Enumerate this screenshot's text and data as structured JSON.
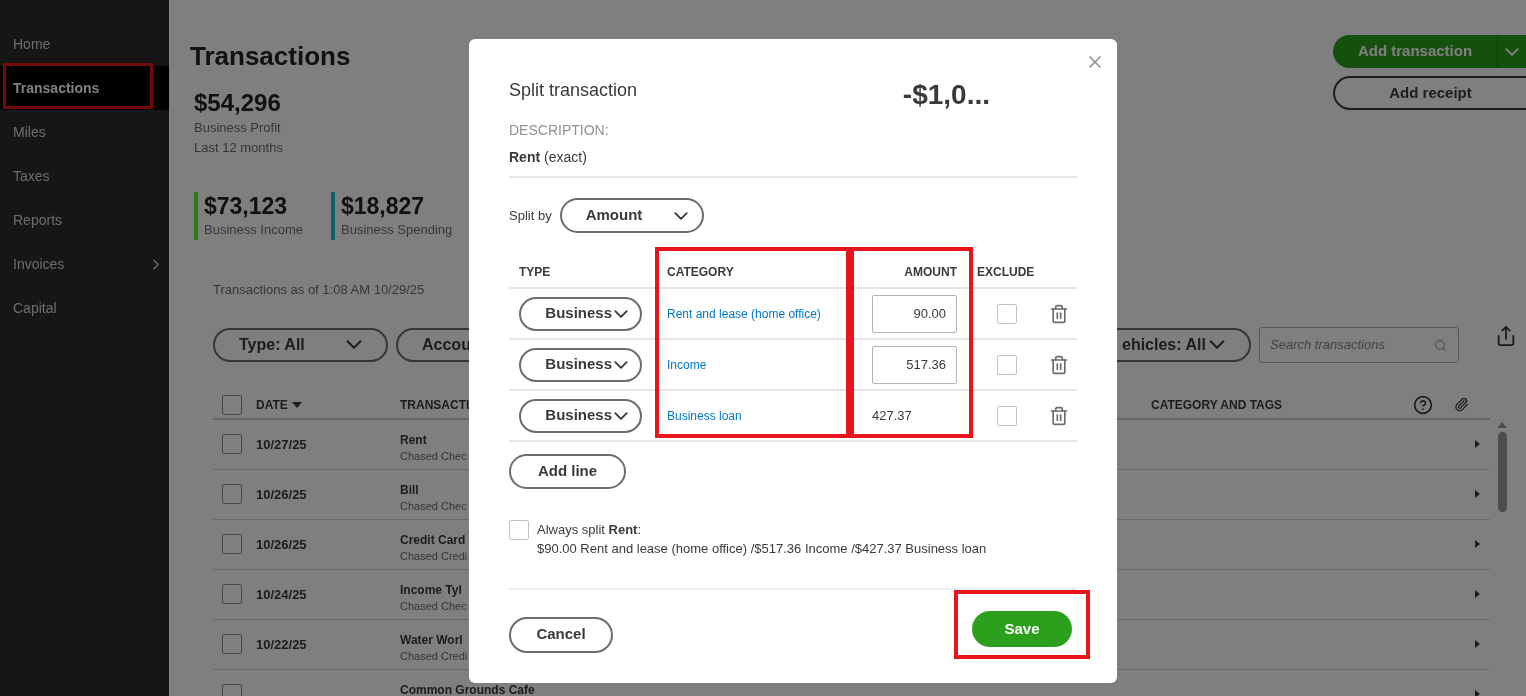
{
  "sidebar": {
    "items": [
      {
        "label": "Home",
        "selected": false,
        "highlighted": false,
        "has_submenu": false
      },
      {
        "label": "Transactions",
        "selected": true,
        "highlighted": true,
        "has_submenu": false
      },
      {
        "label": "Miles",
        "selected": false,
        "highlighted": false,
        "has_submenu": false
      },
      {
        "label": "Taxes",
        "selected": false,
        "highlighted": false,
        "has_submenu": false
      },
      {
        "label": "Reports",
        "selected": false,
        "highlighted": false,
        "has_submenu": false
      },
      {
        "label": "Invoices",
        "selected": false,
        "highlighted": false,
        "has_submenu": true
      },
      {
        "label": "Capital",
        "selected": false,
        "highlighted": false,
        "has_submenu": false
      }
    ]
  },
  "page": {
    "title": "Transactions",
    "profit": {
      "amount": "$54,296",
      "label": "Business Profit",
      "period": "Last 12 months"
    },
    "stats": [
      {
        "amount": "$73,123",
        "label": "Business Income",
        "color": "#2e7a12"
      },
      {
        "amount": "$18,827",
        "label": "Business Spending",
        "color": "#0b5f6b"
      }
    ],
    "actions": {
      "primary": "Add transaction",
      "secondary": "Add receipt"
    },
    "as_of": "Transactions as of 1:08 AM 10/29/25",
    "filters": [
      {
        "label": "Type: All"
      },
      {
        "label": "Accou"
      },
      {
        "label": "ehicles: All"
      }
    ],
    "search": {
      "placeholder": "Search transactions"
    },
    "table": {
      "columns": [
        "DATE",
        "TRANSACTI",
        "CATEGORY AND TAGS"
      ],
      "select_all": {
        "checked": false
      },
      "rows": [
        {
          "date": "10/27/25",
          "name": "Rent",
          "account": "Chased Chec",
          "checked": false
        },
        {
          "date": "10/26/25",
          "name": "Bill",
          "account": "Chased Chec",
          "checked": false
        },
        {
          "date": "10/26/25",
          "name": "Credit Card",
          "account": "Chased Credi",
          "checked": false
        },
        {
          "date": "10/24/25",
          "name": "Income Tyl",
          "account": "Chased Chec",
          "checked": false
        },
        {
          "date": "10/22/25",
          "name": "Water Worl",
          "account": "Chased Credi",
          "checked": false
        },
        {
          "name": "Common Grounds Cafe",
          "checked": false
        }
      ]
    }
  },
  "modal": {
    "title": "Split transaction",
    "amount": "-$1,0...",
    "description_label": "DESCRIPTION:",
    "description": "**Rent** (exact)",
    "split_by": {
      "label": "Split by",
      "value": "Amount"
    },
    "columns": [
      {
        "label": "TYPE",
        "highlighted": false
      },
      {
        "label": "CATEGORY",
        "highlighted": true
      },
      {
        "label": "AMOUNT",
        "highlighted": true
      },
      {
        "label": "EXCLUDE",
        "highlighted": false
      }
    ],
    "lines": [
      {
        "type": "Business",
        "category": "Rent and lease (home office)",
        "amount": "90.00",
        "editable": true,
        "excluded": false
      },
      {
        "type": "Business",
        "category": "Income",
        "amount": "517.36",
        "editable": true,
        "excluded": false
      },
      {
        "type": "Business",
        "category": "Business loan",
        "amount": "427.37",
        "editable": false,
        "excluded": false
      }
    ],
    "add_line": "Add line",
    "always_split": {
      "checked": false,
      "text": "Always split **Rent**:",
      "summary": "$90.00 Rent and lease (home office) /$517.36 Income /$427.37 Business loan"
    },
    "cancel": "Cancel",
    "save": {
      "label": "Save",
      "highlighted": true
    }
  }
}
